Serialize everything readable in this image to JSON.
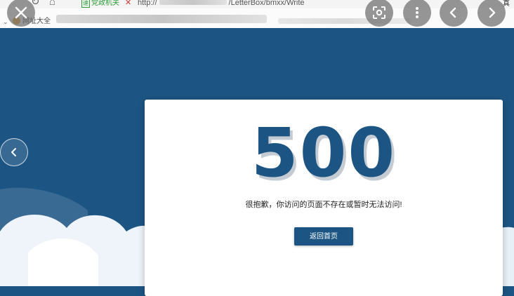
{
  "browser": {
    "tab_label": "党政机关",
    "tab_badge": "速",
    "address_prefix": "http://",
    "address_suffix": "/LetterBox/bmxx/Write",
    "bookmark_label": "网址大全",
    "far_right_char": "真"
  },
  "error_page": {
    "code": "500",
    "message": "很抱歉，你访问的页面不存在或暂时无法访问!",
    "home_button": "返回首页"
  },
  "colors": {
    "page_background": "#1c5583",
    "accent": "#1c5583",
    "card": "#ffffff"
  },
  "icons": {
    "close": "close-icon",
    "scan": "scan-icon",
    "more": "more-vertical-icon",
    "prev": "chevron-left-icon",
    "next": "chevron-right-icon",
    "side_prev": "chevron-left-icon"
  }
}
